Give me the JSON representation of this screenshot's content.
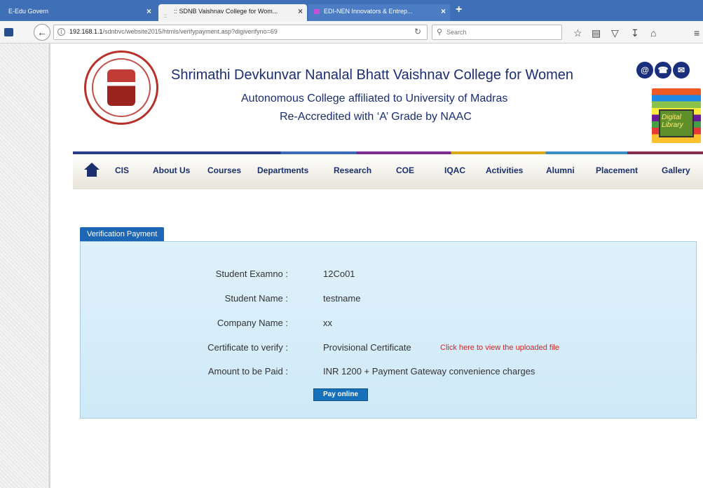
{
  "browser": {
    "tabs": [
      {
        "label": "E-Edu Govern"
      },
      {
        "label": ":: SDNB Vaishnav College for Wom..."
      },
      {
        "label": "EDI-NEN Innovators & Entrep..."
      }
    ],
    "url_host": "192.168.1.1",
    "url_path": "/sdnbvc/website2015/htmls/verifypayment.asp?digiverifyno=69",
    "search_placeholder": "Search"
  },
  "header": {
    "college_name": "Shrimathi Devkunvar Nanalal Bhatt Vaishnav College for Women",
    "subtitle1": "Autonomous College affiliated to University of Madras",
    "subtitle2": "Re-Accredited with ‘A’ Grade by NAAC",
    "digital_library": "Digital Library"
  },
  "menu": {
    "items": [
      {
        "label": "CIS"
      },
      {
        "label": "About Us"
      },
      {
        "label": "Courses"
      },
      {
        "label": "Departments"
      },
      {
        "label": "Research"
      },
      {
        "label": "COE"
      },
      {
        "label": "IQAC"
      },
      {
        "label": "Activities"
      },
      {
        "label": "Alumni"
      },
      {
        "label": "Placement"
      },
      {
        "label": "Gallery"
      }
    ]
  },
  "verification": {
    "tab_label": "Verification Payment",
    "fields": [
      {
        "label": "Student Examno :",
        "value": "12Co01"
      },
      {
        "label": "Student Name :",
        "value": "testname"
      },
      {
        "label": "Company Name :",
        "value": "xx"
      },
      {
        "label": "Certificate to verify :",
        "value": "Provisional Certificate"
      },
      {
        "label": "Amount to be Paid :",
        "value": "INR 1200 + Payment Gateway convenience charges"
      }
    ],
    "view_file_link": "Click here to view the uploaded file",
    "pay_button": "Pay online"
  }
}
